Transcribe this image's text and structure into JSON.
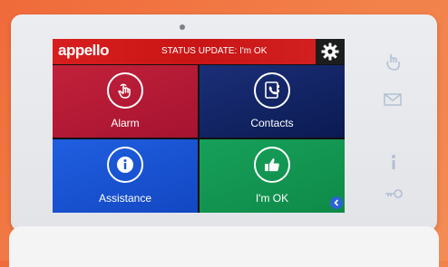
{
  "header": {
    "logo": "appello",
    "status": "STATUS UPDATE: I'm OK"
  },
  "tiles": [
    {
      "label": "Alarm",
      "icon": "touch-icon"
    },
    {
      "label": "Contacts",
      "icon": "address-book-icon"
    },
    {
      "label": "Assistance",
      "icon": "info-icon"
    },
    {
      "label": "I'm OK",
      "icon": "thumbs-up-icon"
    }
  ],
  "colors": {
    "status_bar": "#d81e1e",
    "alarm": "#b01a35",
    "contacts": "#13235f",
    "assistance": "#1a53d6",
    "ok": "#13965095",
    "background": "#f06a3a"
  }
}
